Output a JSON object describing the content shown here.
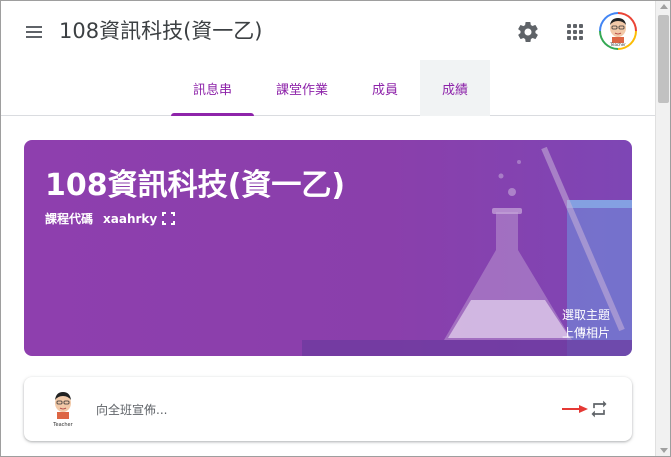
{
  "header": {
    "title": "108資訊科技(資一乙)",
    "icons": {
      "menu": "menu-icon",
      "settings": "gear-icon",
      "apps": "apps-grid-icon",
      "account": "avatar"
    },
    "avatar_label": "Teacher"
  },
  "tabs": [
    {
      "label": "訊息串",
      "active": true
    },
    {
      "label": "課堂作業",
      "active": false
    },
    {
      "label": "成員",
      "active": false
    },
    {
      "label": "成績",
      "active": false
    }
  ],
  "banner": {
    "title": "108資訊科技(資一乙)",
    "code_label": "課程代碼",
    "code_value": "xaahrky",
    "select_theme": "選取主題",
    "upload_photo": "上傳相片",
    "color": "#8e3fae"
  },
  "announce": {
    "placeholder": "向全班宣佈...",
    "avatar_label": "Teacher"
  },
  "colors": {
    "accent": "#8e24aa",
    "arrow": "#e53935",
    "text": "#3c4043"
  }
}
